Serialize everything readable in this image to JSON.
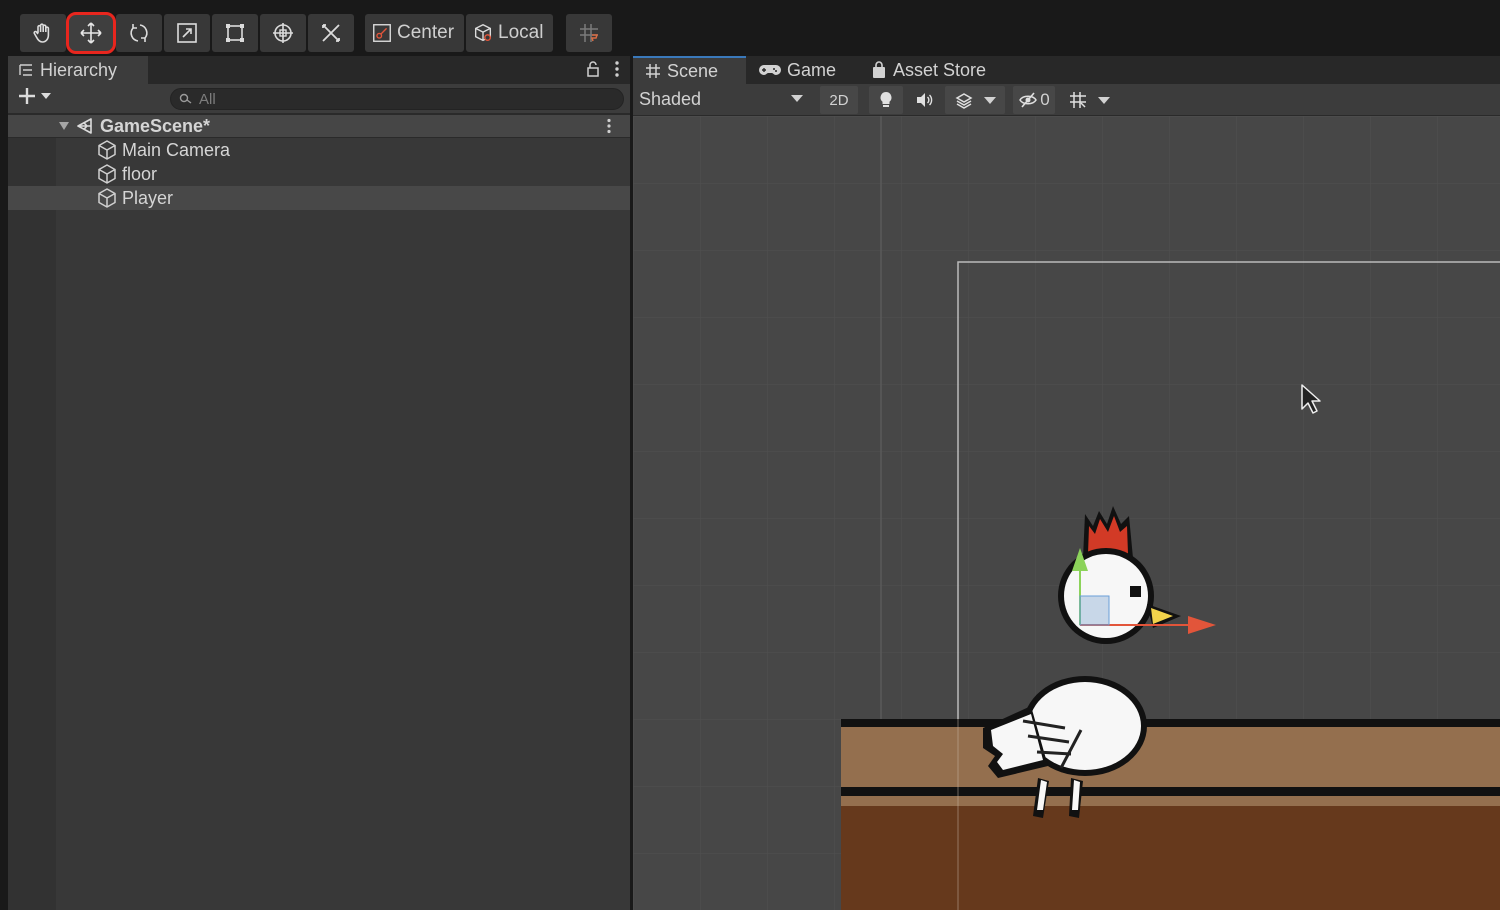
{
  "toolbar": {
    "tools": [
      {
        "name": "hand-tool",
        "icon": "hand-icon",
        "active": false
      },
      {
        "name": "move-tool",
        "icon": "move-arrows-icon",
        "active": true
      },
      {
        "name": "rotate-tool",
        "icon": "rotate-icon",
        "active": false
      },
      {
        "name": "scale-tool",
        "icon": "scale-icon",
        "active": false
      },
      {
        "name": "rect-tool",
        "icon": "rect-transform-icon",
        "active": false
      },
      {
        "name": "transform-tool",
        "icon": "transform-icon",
        "active": false
      },
      {
        "name": "custom-tool",
        "icon": "custom-tools-icon",
        "active": false
      }
    ],
    "pivot_label": "Center",
    "space_label": "Local",
    "highlight_color": "#e8261e"
  },
  "hierarchy": {
    "tab_label": "Hierarchy",
    "search_placeholder": "All",
    "scene_name": "GameScene*",
    "items": [
      {
        "label": "Main Camera"
      },
      {
        "label": "floor"
      },
      {
        "label": "Player"
      }
    ]
  },
  "scene_view": {
    "tabs": [
      {
        "label": "Scene",
        "icon": "grid-icon",
        "active": true
      },
      {
        "label": "Game",
        "icon": "gamepad-icon",
        "active": false
      },
      {
        "label": "Asset Store",
        "icon": "shopping-bag-icon",
        "active": false
      }
    ],
    "shading_mode": "Shaded",
    "mode_2d_label": "2D",
    "hidden_count": "0",
    "gizmo_colors": {
      "y_axis": "#8cd35a",
      "x_axis": "#e2553a"
    }
  }
}
